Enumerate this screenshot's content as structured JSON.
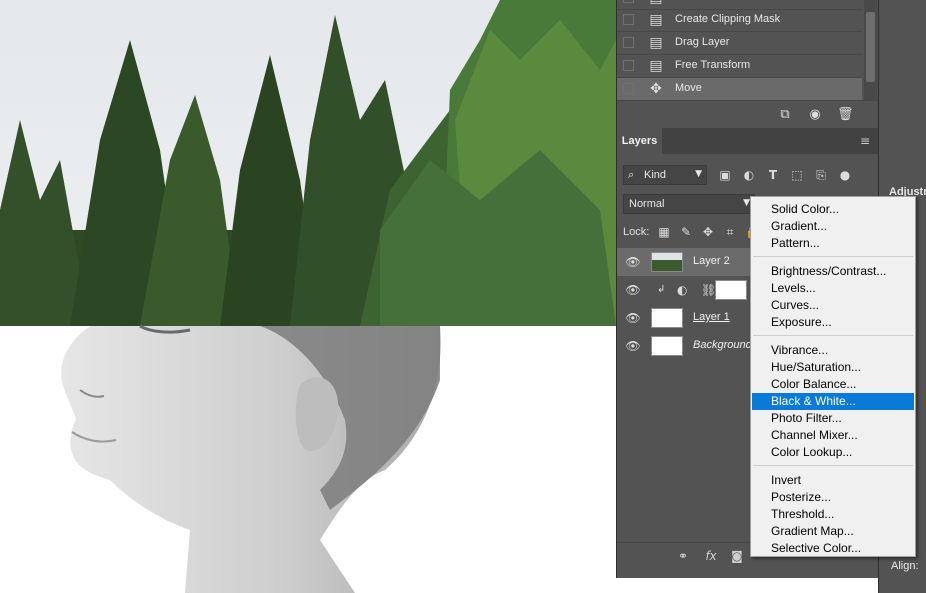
{
  "history": {
    "items": [
      {
        "label": "Create Clipping Mask",
        "icon": "document-icon",
        "active": false
      },
      {
        "label": "Drag Layer",
        "icon": "document-icon",
        "active": false
      },
      {
        "label": "Free Transform",
        "icon": "document-icon",
        "active": false
      },
      {
        "label": "Move",
        "icon": "move-icon",
        "active": true
      }
    ],
    "footer_icons": [
      "new-document-from-state-icon",
      "camera-icon",
      "trash-icon"
    ]
  },
  "layers_panel": {
    "tab_label": "Layers",
    "filter_kind": "Kind",
    "filter_icons": [
      "image-filter-icon",
      "adjustment-filter-icon",
      "type-filter-icon",
      "shape-filter-icon",
      "smart-object-filter-icon"
    ],
    "blend_mode": "Normal",
    "lock_label": "Lock:",
    "layers": [
      {
        "name": "Layer 2",
        "type": "image",
        "selected": true
      },
      {
        "name": "",
        "type": "adjustment",
        "selected": false
      },
      {
        "name": "Layer 1",
        "type": "image",
        "selected": false
      },
      {
        "name": "Background",
        "type": "background",
        "selected": false
      }
    ],
    "footer_icons": [
      "link-icon",
      "fx-icon",
      "mask-icon"
    ]
  },
  "adjustment_menu": {
    "groups": [
      [
        "Solid Color...",
        "Gradient...",
        "Pattern..."
      ],
      [
        "Brightness/Contrast...",
        "Levels...",
        "Curves...",
        "Exposure..."
      ],
      [
        "Vibrance...",
        "Hue/Saturation...",
        "Color Balance...",
        "Black & White...",
        "Photo Filter...",
        "Channel Mixer...",
        "Color Lookup..."
      ],
      [
        "Invert",
        "Posterize...",
        "Threshold...",
        "Gradient Map...",
        "Selective Color..."
      ]
    ],
    "highlighted": "Black & White..."
  },
  "right_strip": {
    "adjustments_label": "Adjustm",
    "align_label": "Align:"
  },
  "colors": {
    "panel_bg": "#535353",
    "highlight": "#0a7ad8",
    "menu_bg": "#f0f0f0"
  }
}
